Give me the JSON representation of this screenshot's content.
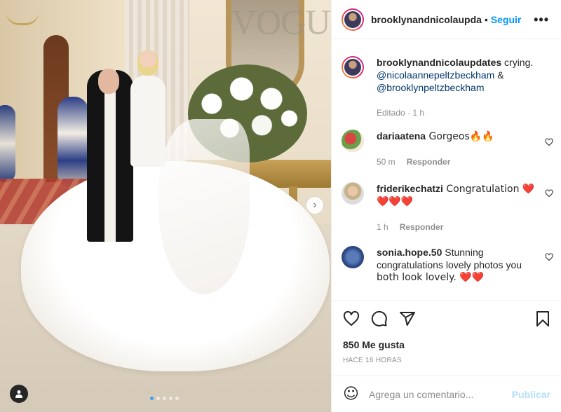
{
  "photo": {
    "watermark": "VOGUE",
    "carousel_dots": 5,
    "active_dot": 0
  },
  "header": {
    "username": "brooklynandnicolaupda",
    "separator": "•",
    "follow_label": "Seguir",
    "more_label": "•••"
  },
  "caption": {
    "username": "brooklynandnicolaupdates",
    "text": " crying.",
    "mention1": "@nicolaannepeltzbeckham",
    "amp": " &",
    "mention2": "@brooklynpeltzbeckham",
    "meta": "Editado · 1 h"
  },
  "comments": [
    {
      "username": "dariaatena",
      "text": " Gorgeos🔥🔥",
      "time": "50 m",
      "reply": "Responder"
    },
    {
      "username": "friderikechatzi",
      "text": " Congratulation ❤️",
      "text2": "❤️❤️❤️",
      "time": "1 h",
      "reply": "Responder"
    },
    {
      "username": "sonia.hope.50",
      "text": " Stunning",
      "text2": "congratulations lovely photos you",
      "text3": "both look lovely. ❤️❤️"
    }
  ],
  "actions": {
    "likes": "850 Me gusta",
    "time_ago": "HACE 16 HORAS"
  },
  "composer": {
    "placeholder": "Agrega un comentario...",
    "publish_label": "Publicar",
    "emoji_icon": "☺"
  },
  "colors": {
    "link_blue": "#0095f6",
    "mention_blue": "#00376b",
    "muted_gray": "#8e8e8e",
    "publish_disabled": "#b2dffc"
  }
}
